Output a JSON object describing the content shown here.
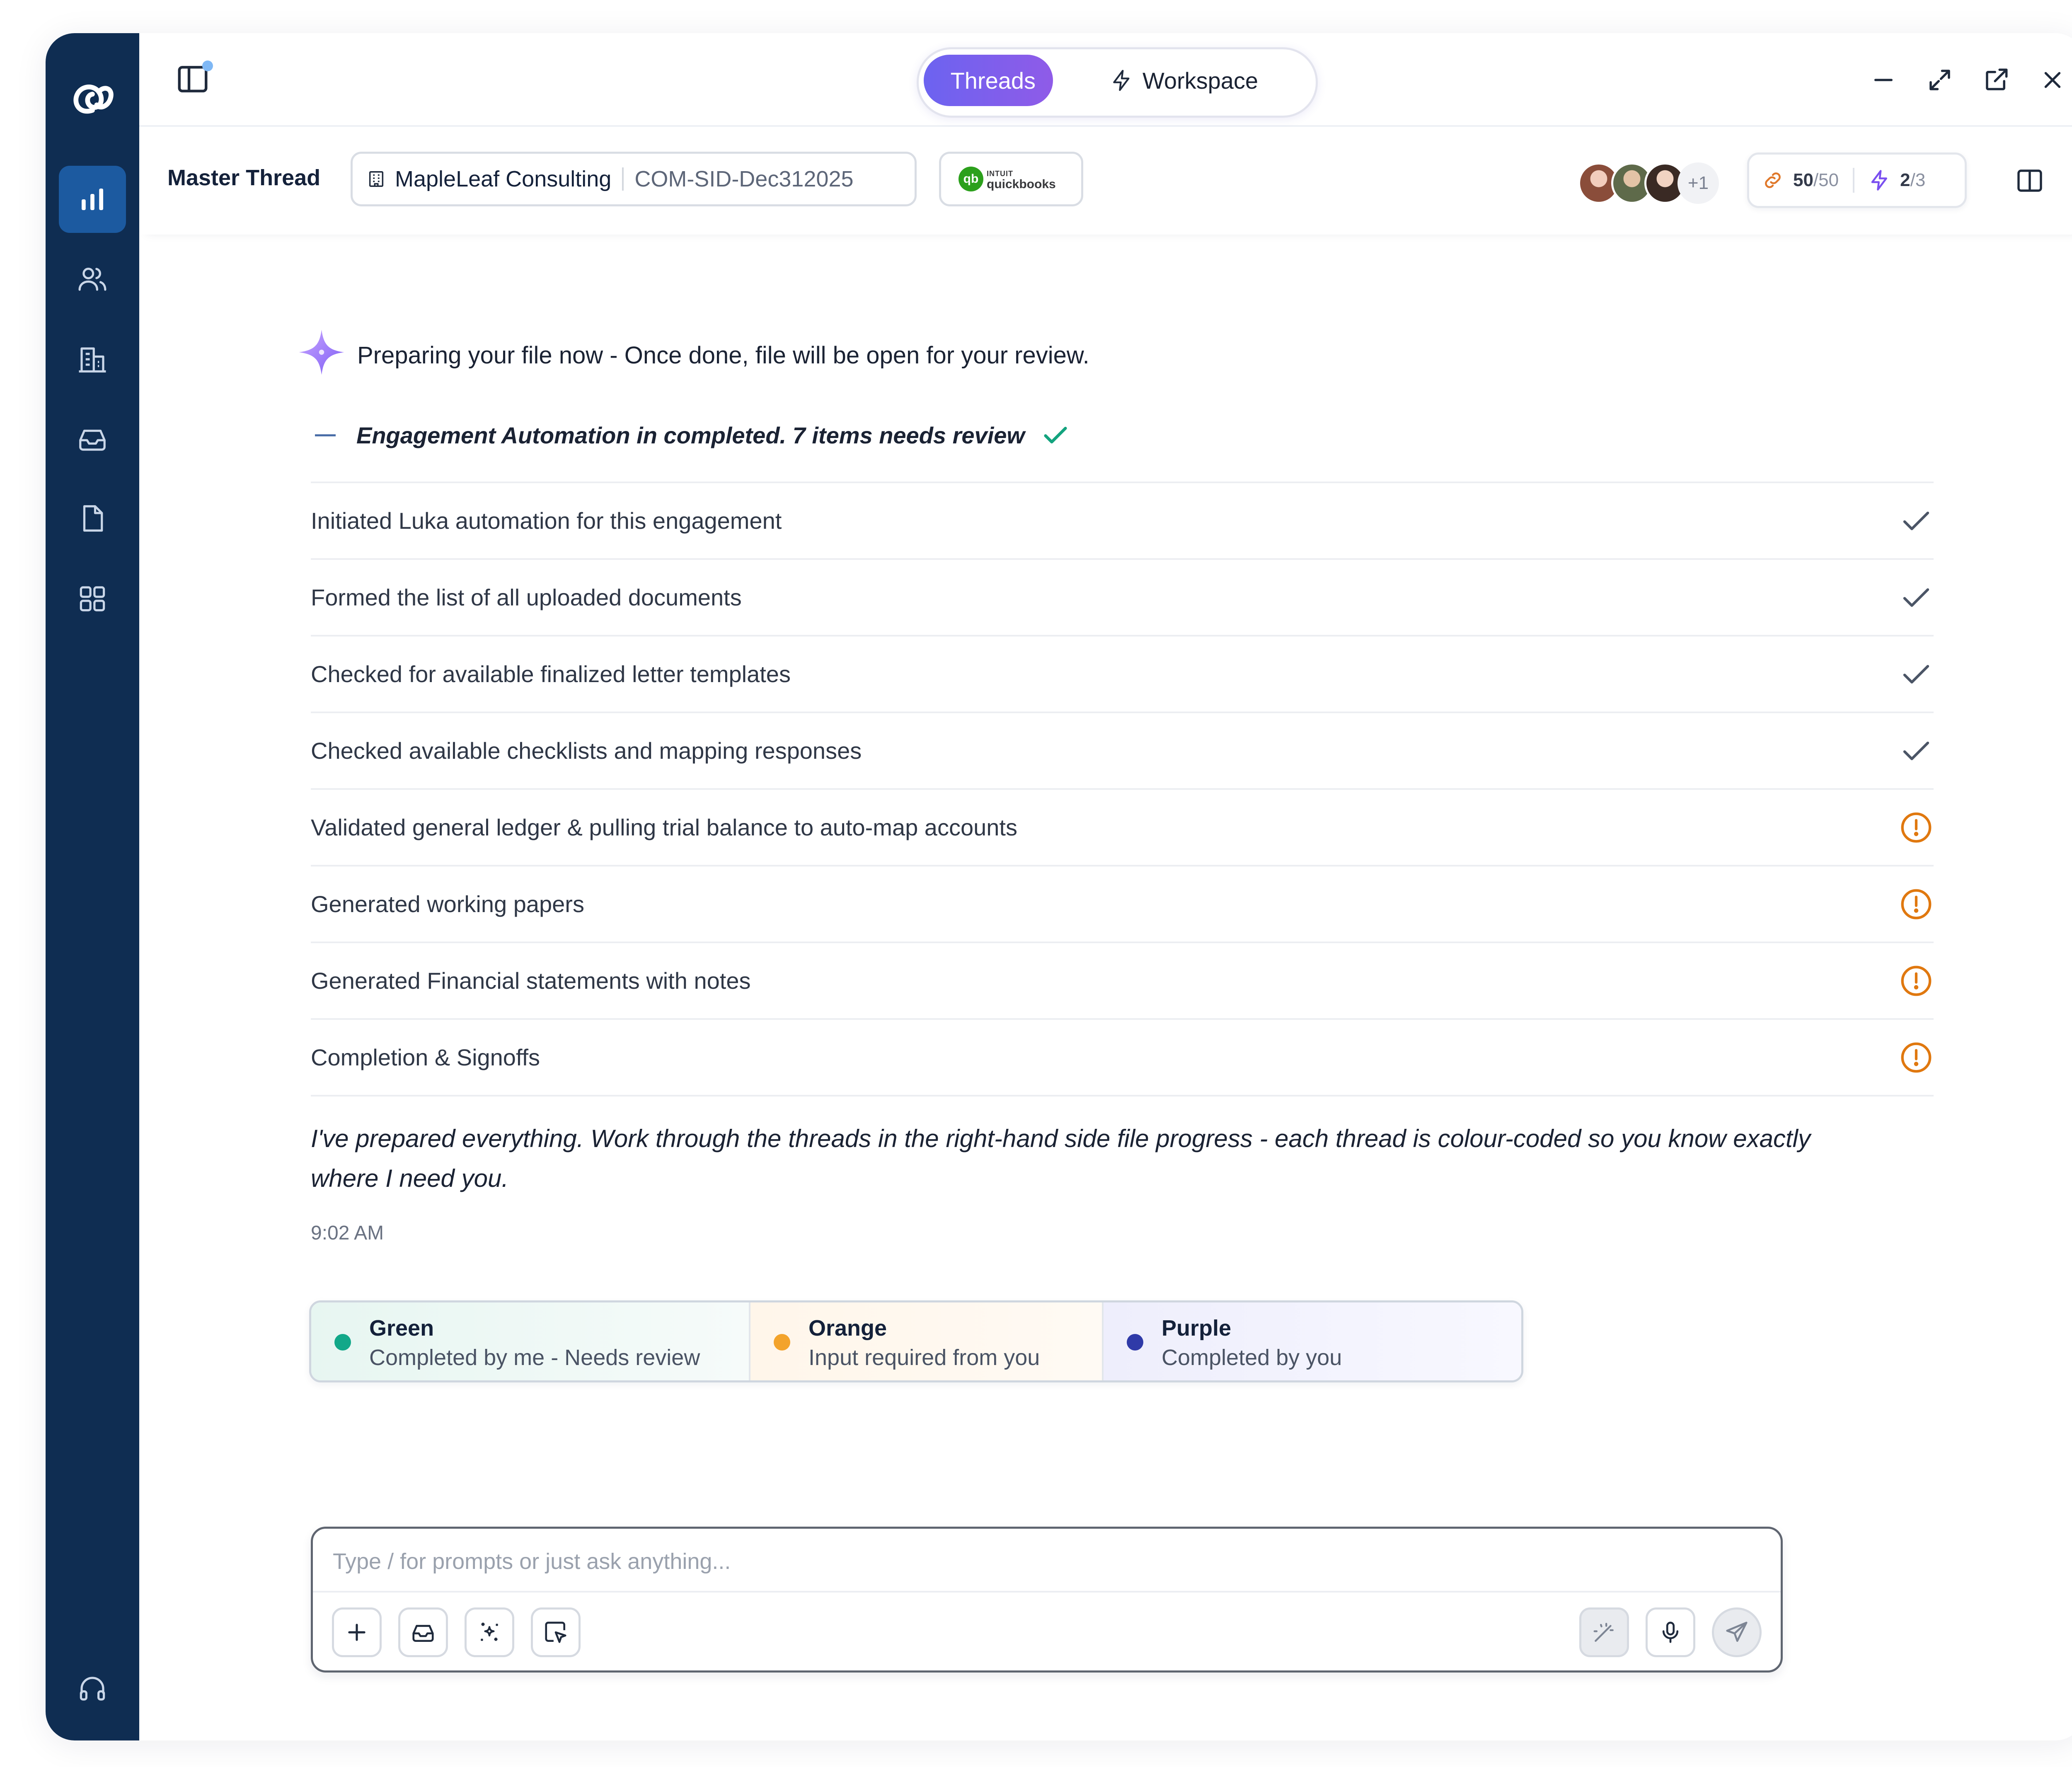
{
  "app": {
    "tabs": [
      {
        "label": "Threads",
        "active": true
      },
      {
        "label": "Workspace",
        "active": false
      }
    ],
    "accent": "#7460ee",
    "rail_color": "#0f2d52",
    "rail_items": [
      "chart-icon",
      "users-icon",
      "building-icon",
      "inbox-icon",
      "document-icon",
      "apps-icon",
      "headset-icon"
    ]
  },
  "header": {
    "title": "Master Thread",
    "client_name": "MapleLeaf Consulting",
    "client_id": "COM-SID-Dec312025",
    "integration": {
      "brand_small": "INTUIT",
      "brand": "quickbooks",
      "mark": "qb"
    },
    "participants_more": "+1",
    "counter_a": {
      "value": "50",
      "total": "/50"
    },
    "counter_b": {
      "value": "2",
      "total": "/3"
    }
  },
  "conversation": {
    "status_message": "Preparing your file now - Once done, file will be open for your review.",
    "engagement_summary": "Engagement Automation in completed. 7 items needs review",
    "steps": [
      {
        "label": "Initiated Luka automation for this engagement",
        "status": "done"
      },
      {
        "label": "Formed the list of all uploaded documents",
        "status": "done"
      },
      {
        "label": "Checked for available finalized letter templates",
        "status": "done"
      },
      {
        "label": "Checked available checklists and mapping responses",
        "status": "done"
      },
      {
        "label": "Validated general ledger & pulling trial balance to auto-map accounts",
        "status": "review"
      },
      {
        "label": "Generated working papers",
        "status": "review"
      },
      {
        "label": "Generated Financial statements with notes",
        "status": "review"
      },
      {
        "label": "Completion & Signoffs",
        "status": "review"
      }
    ],
    "final_message": "I've prepared everything. Work through the threads in the right-hand side file progress - each thread is colour-coded so you know exactly where I need you.",
    "time": "9:02 AM",
    "legend": [
      {
        "title": "Green",
        "desc": "Completed by me - Needs review",
        "color": "#12a889"
      },
      {
        "title": "Orange",
        "desc": "Input required from you",
        "color": "#f3a32b"
      },
      {
        "title": "Purple",
        "desc": "Completed by you",
        "color": "#2f3aa8"
      }
    ]
  },
  "composer": {
    "placeholder": "Type / for prompts or just ask anything..."
  }
}
